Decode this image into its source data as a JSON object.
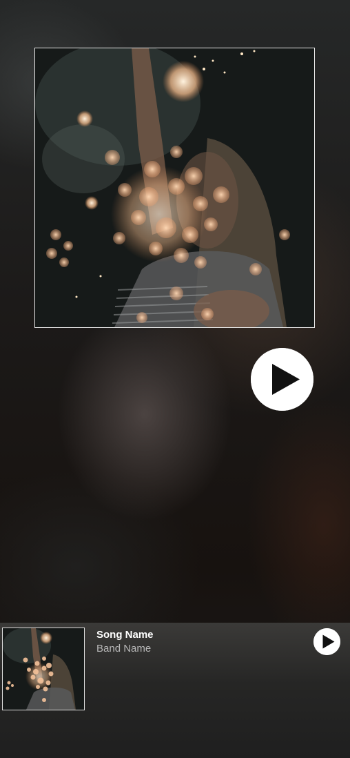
{
  "now_playing": {
    "cover_alt": "album-art",
    "play_icon": "play-icon"
  },
  "mini_player": {
    "song_name": "Song Name",
    "band_name": "Band Name",
    "play_icon": "play-icon"
  },
  "colors": {
    "play_button": "#ffffff",
    "play_glyph": "#111111",
    "cover_border": "#e8e8e8",
    "song_name": "#ffffff",
    "band_name": "#b8b8b8"
  }
}
